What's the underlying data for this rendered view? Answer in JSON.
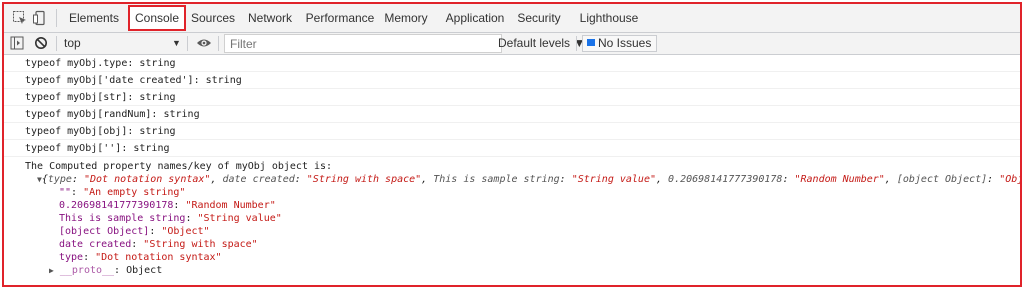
{
  "tabs": [
    {
      "label": "Elements"
    },
    {
      "label": "Console"
    },
    {
      "label": "Sources"
    },
    {
      "label": "Network"
    },
    {
      "label": "Performance"
    },
    {
      "label": "Memory"
    },
    {
      "label": "Application"
    },
    {
      "label": "Security"
    },
    {
      "label": "Lighthouse"
    }
  ],
  "active_tab": "Console",
  "toolbar": {
    "context": "top",
    "filter_placeholder": "Filter",
    "levels_label": "Default levels ▼",
    "issues_label": "No Issues"
  },
  "messages": [
    "typeof myObj.type: string",
    "typeof myObj['date created']: string",
    "typeof myObj[str]: string",
    "typeof myObj[randNum]: string",
    "typeof myObj[obj]: string",
    "typeof myObj['']: string"
  ],
  "object_log": {
    "heading": "The Computed property names/key of myObj object is:",
    "summary": {
      "open": "{",
      "k1": "type",
      "v1": "\"Dot notation syntax\"",
      "k2": "date created",
      "v2": "\"String with space\"",
      "k3": "This is sample string",
      "v3": "\"String value\"",
      "k4": "0.20698141777390178",
      "v4": "\"Random Number\"",
      "k5": "[object Object]",
      "v5": "\"Object\"",
      "tail": ", …}"
    },
    "properties": [
      {
        "key": "\"\"",
        "value": "\"An empty string\""
      },
      {
        "key": "0.20698141777390178",
        "value": "\"Random Number\""
      },
      {
        "key": "This is sample string",
        "value": "\"String value\""
      },
      {
        "key": "[object Object]",
        "value": "\"Object\""
      },
      {
        "key": "date created",
        "value": "\"String with space\""
      },
      {
        "key": "type",
        "value": "\"Dot notation syntax\""
      }
    ],
    "proto_key": "__proto__",
    "proto_value": "Object"
  },
  "colors": {
    "accent": "#e0232a",
    "key": "#881280",
    "string": "#c41a16"
  }
}
